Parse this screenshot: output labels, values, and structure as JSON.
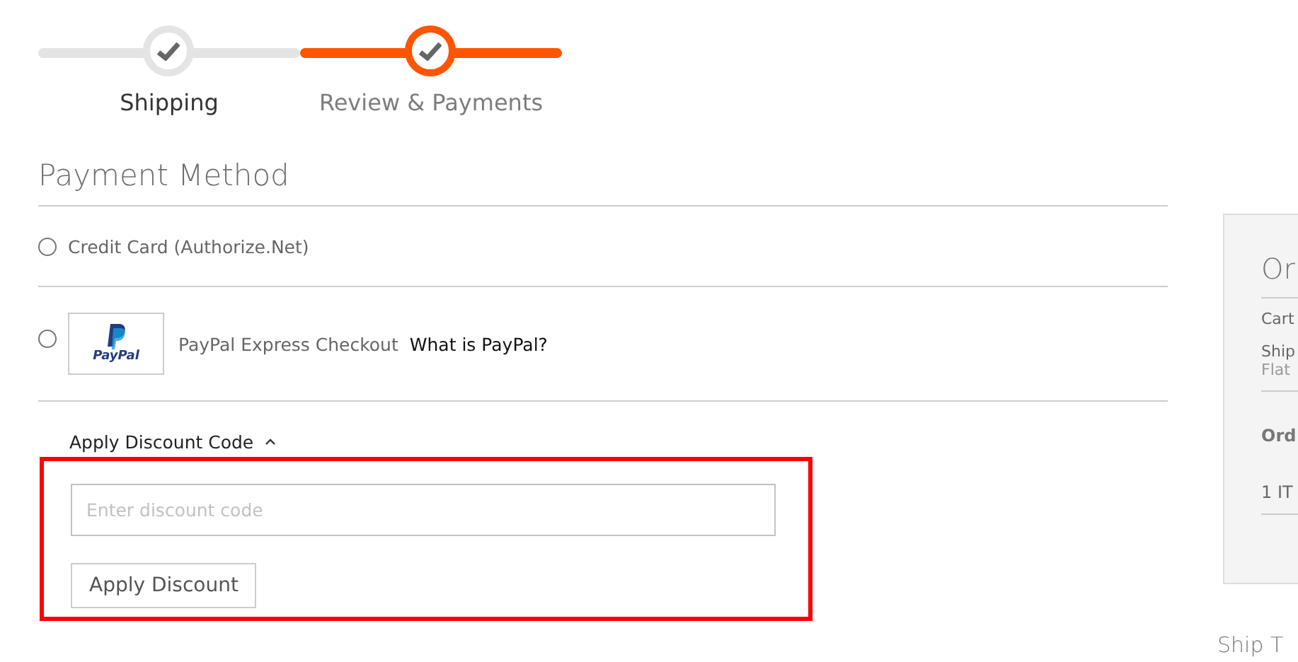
{
  "progress": {
    "steps": [
      {
        "label": "Shipping",
        "selected": false
      },
      {
        "label": "Review & Payments",
        "selected": true
      }
    ]
  },
  "payment": {
    "title": "Payment Method",
    "methods": [
      {
        "kind": "plain",
        "label": "Credit Card (Authorize.Net)",
        "selected": false
      },
      {
        "kind": "paypal",
        "label": "PayPal Express Checkout",
        "link": "What is PayPal?",
        "logo_text": "PayPal",
        "selected": false
      }
    ]
  },
  "discount": {
    "title": "Apply Discount Code",
    "expanded": true,
    "placeholder": "Enter discount code",
    "button": "Apply Discount"
  },
  "summary": {
    "title": "Or",
    "rows": [
      {
        "label": "Cart"
      },
      {
        "label": "Ship",
        "detail": "Flat"
      }
    ],
    "order_label": "Ord",
    "items": "1 IT"
  },
  "ship_to": {
    "title": "Ship T"
  }
}
